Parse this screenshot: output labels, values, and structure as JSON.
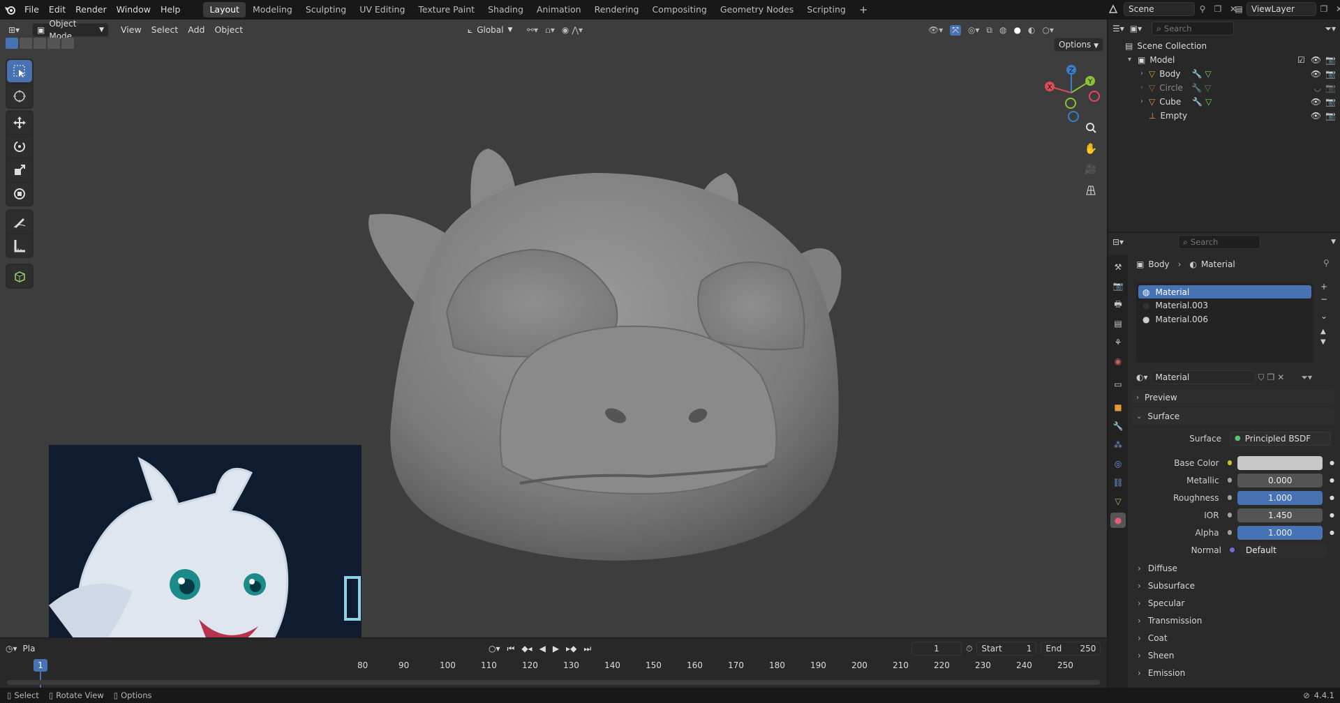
{
  "menus": [
    "File",
    "Edit",
    "Render",
    "Window",
    "Help"
  ],
  "workspaces": [
    "Layout",
    "Modeling",
    "Sculpting",
    "UV Editing",
    "Texture Paint",
    "Shading",
    "Animation",
    "Rendering",
    "Compositing",
    "Geometry Nodes",
    "Scripting"
  ],
  "active_workspace": "Layout",
  "add_workspace": "+",
  "scene": "Scene",
  "view_layer": "ViewLayer",
  "viewport": {
    "mode": "Object Mode",
    "menus": [
      "View",
      "Select",
      "Add",
      "Object"
    ],
    "orientation": "Global",
    "options_label": "Options",
    "axes": {
      "x": "X",
      "y": "Y",
      "z": "Z"
    }
  },
  "outliner": {
    "search_placeholder": "Search",
    "collection": "Scene Collection",
    "items": [
      {
        "name": "Model",
        "level": 0
      },
      {
        "name": "Body",
        "level": 1
      },
      {
        "name": "Circle",
        "level": 1
      },
      {
        "name": "Cube",
        "level": 1
      },
      {
        "name": "Empty",
        "level": 1
      }
    ]
  },
  "properties": {
    "search_placeholder": "Search",
    "breadcrumb": [
      "Body",
      "Material"
    ],
    "slots": [
      "Material",
      "Material.003",
      "Material.006"
    ],
    "active_material": "Material",
    "panels": {
      "preview": "Preview",
      "surface": "Surface"
    },
    "surface_label": "Surface",
    "surface_shader": "Principled BSDF",
    "fields": [
      {
        "label": "Base Color",
        "value": ""
      },
      {
        "label": "Metallic",
        "value": "0.000"
      },
      {
        "label": "Roughness",
        "value": "1.000"
      },
      {
        "label": "IOR",
        "value": "1.450"
      },
      {
        "label": "Alpha",
        "value": "1.000"
      },
      {
        "label": "Normal",
        "value": "Default"
      }
    ],
    "subpanels": [
      "Diffuse",
      "Subsurface",
      "Specular",
      "Transmission",
      "Coat",
      "Sheen",
      "Emission"
    ],
    "colors": {
      "base_color": "#c8c8c8",
      "accent": "#4772b3"
    }
  },
  "timeline": {
    "playback_label": "Pla",
    "current_frame": "1",
    "start_label": "Start",
    "start": "1",
    "end_label": "End",
    "end": "250",
    "ticks": [
      "80",
      "90",
      "100",
      "110",
      "120",
      "130",
      "140",
      "150",
      "160",
      "170",
      "180",
      "190",
      "200",
      "210",
      "220",
      "230",
      "240",
      "250"
    ],
    "playhead": "1"
  },
  "status": {
    "select": "Select",
    "rotate": "Rotate View",
    "options": "Options",
    "version": "4.4.1"
  }
}
